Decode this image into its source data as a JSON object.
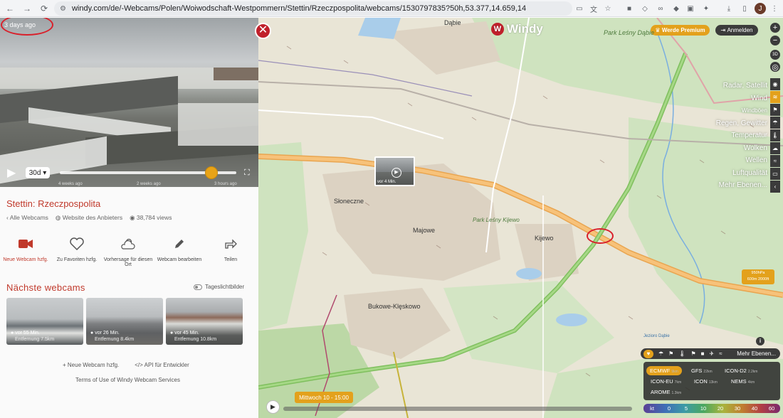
{
  "browser": {
    "url": "windy.com/de/-Webcams/Polen/Woiwodschaft-Westpommern/Stettin/Rzeczpospolita/webcams/1530797835?50h,53.377,14.659,14"
  },
  "webcam": {
    "timestamp": "3 days ago",
    "range": "30d",
    "timeline_labels": [
      "4 weeks ago",
      "2 weeks ago",
      "3 hours ago"
    ],
    "progress": 0.86,
    "title": "Stettin: Rzeczpospolita",
    "links": {
      "all_webcams": "Alle Webcams",
      "provider": "Website des Anbieters",
      "views": "38,784 views"
    },
    "actions": [
      {
        "label": "Neue Webcam hzfg.",
        "icon": "webcam-icon",
        "active": true
      },
      {
        "label": "Zu Favoriten hzfg.",
        "icon": "heart-icon",
        "active": false
      },
      {
        "label": "Vorhersage für diesen Ort",
        "icon": "weather-icon",
        "active": false
      },
      {
        "label": "Webcam bearbeiten",
        "icon": "pencil-icon",
        "active": false
      },
      {
        "label": "Teilen",
        "icon": "share-icon",
        "active": false
      }
    ],
    "nearby_title": "Nächste webcams",
    "daylight_label": "Tageslichtbilder",
    "nearby": [
      {
        "age": "vor 55 Min.",
        "distance": "Entfernung 7.5km"
      },
      {
        "age": "vor 26 Min.",
        "distance": "Entfernung 8.4km"
      },
      {
        "age": "vor 45 Min.",
        "distance": "Entfernung 10.8km"
      }
    ],
    "bottom_links": {
      "add": "Neue Webcam hzfg.",
      "api": "API für Entwickler"
    },
    "terms": "Terms of Use of Windy Webcam Services"
  },
  "map": {
    "logo": "Windy",
    "premium_label": "Werde Premium",
    "login_label": "Anmelden",
    "zoom_in": "+",
    "zoom_out": "−",
    "layer_labels": [
      "Radar, Satellit",
      "Wind",
      "Windböen",
      "Regen, Gewitter",
      "Temperatur",
      "Wolken",
      "Wellen",
      "Luftqualität",
      "Mehr Ebenen..."
    ],
    "places": [
      {
        "name": "Dąbie"
      },
      {
        "name": "Park Leśny Dąbie"
      },
      {
        "name": "Słoneczne"
      },
      {
        "name": "Majowe"
      },
      {
        "name": "Park Leśny Kijewo"
      },
      {
        "name": "Kijewo"
      },
      {
        "name": "Bukowe-Klęskowo"
      },
      {
        "name": "Jezioro Dąbie"
      }
    ],
    "cam_pin_label": "vor 4 Min.",
    "pressure": [
      "950hPa",
      "600m 2000ft"
    ],
    "layer_bar": {
      "more": "Mehr Ebenen..."
    },
    "models": [
      {
        "name": "ECMWF",
        "res": "9km",
        "selected": true
      },
      {
        "name": "GFS",
        "res": "22km"
      },
      {
        "name": "ICON-D2",
        "res": "2.2km"
      },
      {
        "name": "ICON-EU",
        "res": "7km"
      },
      {
        "name": "ICON",
        "res": "13km"
      },
      {
        "name": "NEMS",
        "res": "4km"
      },
      {
        "name": "AROME",
        "res": "1.3km"
      }
    ],
    "legend": [
      "kt",
      "0",
      "5",
      "10",
      "20",
      "30",
      "40",
      "60"
    ],
    "date": "Mittwoch 10 - 15:00"
  }
}
